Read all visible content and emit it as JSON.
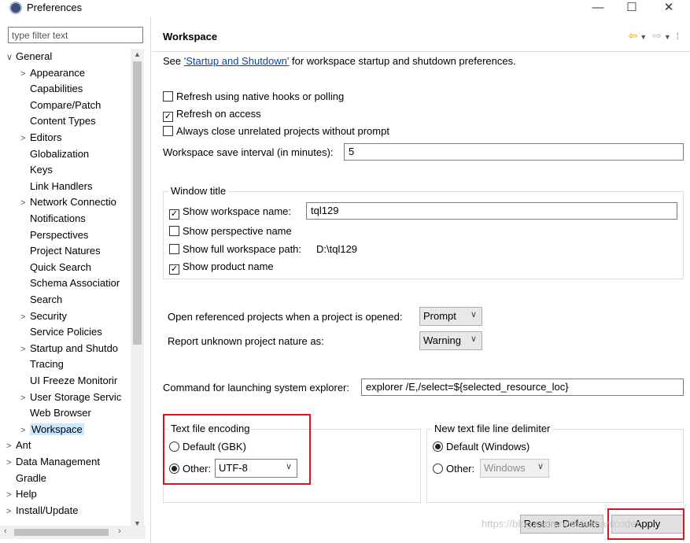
{
  "window": {
    "title": "Preferences",
    "min_glyph": "—",
    "max_glyph": "☐",
    "close_glyph": "✕"
  },
  "filter": {
    "placeholder": "type filter text"
  },
  "tree": [
    {
      "label": "General",
      "level": 0,
      "twisty": "∨"
    },
    {
      "label": "Appearance",
      "level": 1,
      "twisty": ">"
    },
    {
      "label": "Capabilities",
      "level": 1,
      "twisty": ""
    },
    {
      "label": "Compare/Patch",
      "level": 1,
      "twisty": ""
    },
    {
      "label": "Content Types",
      "level": 1,
      "twisty": ""
    },
    {
      "label": "Editors",
      "level": 1,
      "twisty": ">"
    },
    {
      "label": "Globalization",
      "level": 1,
      "twisty": ""
    },
    {
      "label": "Keys",
      "level": 1,
      "twisty": ""
    },
    {
      "label": "Link Handlers",
      "level": 1,
      "twisty": ""
    },
    {
      "label": "Network Connectio",
      "level": 1,
      "twisty": ">"
    },
    {
      "label": "Notifications",
      "level": 1,
      "twisty": ""
    },
    {
      "label": "Perspectives",
      "level": 1,
      "twisty": ""
    },
    {
      "label": "Project Natures",
      "level": 1,
      "twisty": ""
    },
    {
      "label": "Quick Search",
      "level": 1,
      "twisty": ""
    },
    {
      "label": "Schema Associatior",
      "level": 1,
      "twisty": ""
    },
    {
      "label": "Search",
      "level": 1,
      "twisty": ""
    },
    {
      "label": "Security",
      "level": 1,
      "twisty": ">"
    },
    {
      "label": "Service Policies",
      "level": 1,
      "twisty": ""
    },
    {
      "label": "Startup and Shutdo",
      "level": 1,
      "twisty": ">"
    },
    {
      "label": "Tracing",
      "level": 1,
      "twisty": ""
    },
    {
      "label": "UI Freeze Monitorir",
      "level": 1,
      "twisty": ""
    },
    {
      "label": "User Storage Servic",
      "level": 1,
      "twisty": ">"
    },
    {
      "label": "Web Browser",
      "level": 1,
      "twisty": ""
    },
    {
      "label": "Workspace",
      "level": 1,
      "twisty": ">",
      "selected": true
    },
    {
      "label": "Ant",
      "level": 0,
      "twisty": ">"
    },
    {
      "label": "Data Management",
      "level": 0,
      "twisty": ">"
    },
    {
      "label": "Gradle",
      "level": 0,
      "twisty": ""
    },
    {
      "label": "Help",
      "level": 0,
      "twisty": ">"
    },
    {
      "label": "Install/Update",
      "level": 0,
      "twisty": ">"
    }
  ],
  "page": {
    "title": "Workspace",
    "desc_prefix": "See ",
    "desc_link": "'Startup and Shutdown'",
    "desc_suffix": " for workspace startup and shutdown preferences.",
    "refresh_native": {
      "label": "Refresh using native hooks or polling",
      "checked": false
    },
    "refresh_access": {
      "label": "Refresh on access",
      "checked": true
    },
    "always_close": {
      "label": "Always close unrelated projects without prompt",
      "checked": false
    },
    "save_interval_label": "Workspace save interval (in minutes):",
    "save_interval_value": "5",
    "window_title_group": "Window title",
    "show_ws_name": {
      "label": "Show workspace name:",
      "checked": true,
      "value": "tql129"
    },
    "show_perspective": {
      "label": "Show perspective name",
      "checked": false
    },
    "show_full_path": {
      "label": "Show full workspace path:",
      "checked": false,
      "value": "D:\\tql129"
    },
    "show_product": {
      "label": "Show product name",
      "checked": true
    },
    "open_ref_label": "Open referenced projects when a project is opened:",
    "open_ref_value": "Prompt",
    "report_unknown_label": "Report unknown project nature as:",
    "report_unknown_value": "Warning",
    "cmd_label": "Command for launching system explorer:",
    "cmd_value": "explorer /E,/select=${selected_resource_loc}",
    "encoding_group": "Text file encoding",
    "encoding_default": "Default (GBK)",
    "encoding_other": "Other:",
    "encoding_value": "UTF-8",
    "delimiter_group": "New text file line delimiter",
    "delimiter_default": "Default (Windows)",
    "delimiter_other": "Other:",
    "delimiter_value": "Windows",
    "restore_defaults": "Restore Defaults",
    "apply": "Apply"
  },
  "watermark": "https://blog.csdn.net/xiaohanlcoder",
  "colors": {
    "highlight": "#d9141e",
    "link": "#0645ad",
    "selection": "#cce8ff"
  }
}
